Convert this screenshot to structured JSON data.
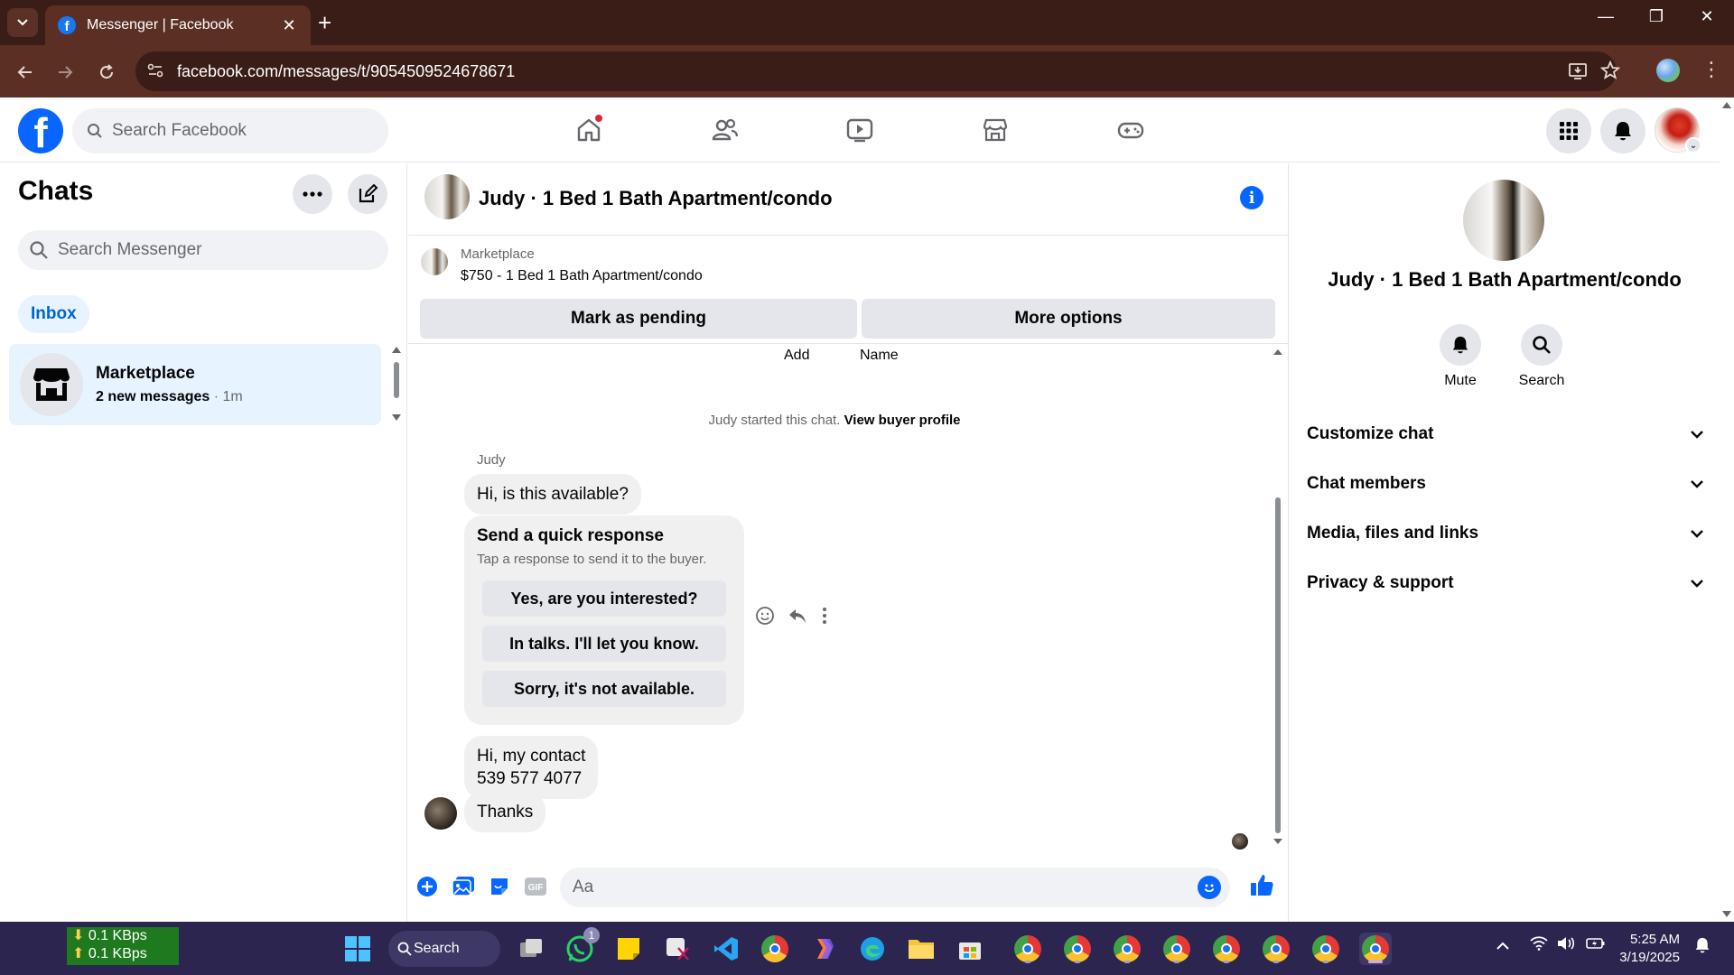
{
  "browser": {
    "tab_title": "Messenger | Facebook",
    "url": "facebook.com/messages/t/9054509524678671"
  },
  "header": {
    "search_placeholder": "Search Facebook"
  },
  "sidebar": {
    "title": "Chats",
    "search_placeholder": "Search Messenger",
    "filter": "Inbox",
    "conversation": {
      "name": "Marketplace",
      "preview": "2 new messages",
      "time": " · 1m"
    }
  },
  "conversation": {
    "title": "Judy · 1 Bed 1 Bath Apartment/condo",
    "marketplace_label": "Marketplace",
    "listing": "$750 - 1 Bed 1 Bath Apartment/condo",
    "mark_pending": "Mark as pending",
    "more_options": "More options",
    "add_label": "Add",
    "name_label": "Name",
    "started_text": "Judy started this chat. ",
    "view_profile": "View buyer profile",
    "sender": "Judy",
    "msg1": "Hi, is this available?",
    "quick_title": "Send a quick response",
    "quick_sub": "Tap a response to send it to the buyer.",
    "quick_responses": [
      "Yes, are you interested?",
      "In talks. I'll let you know.",
      "Sorry, it's not available."
    ],
    "msg2_line1": "Hi, my contact",
    "msg2_line2": "539 577 4077",
    "msg3": "Thanks",
    "composer_placeholder": "Aa"
  },
  "details": {
    "title": "Judy · 1 Bed 1 Bath Apartment/condo",
    "mute": "Mute",
    "search": "Search",
    "sections": [
      "Customize chat",
      "Chat members",
      "Media, files and links",
      "Privacy & support"
    ]
  },
  "taskbar": {
    "net_down": "0.1 KBps",
    "net_up": "0.1 KBps",
    "search": "Search",
    "whatsapp_badge": "1",
    "time": "5:25 AM",
    "date": "3/19/2025"
  },
  "colors": {
    "brand_blue": "#0866ff",
    "chrome_frame": "#5b2f24",
    "selected_bg": "#e7f3ff"
  }
}
